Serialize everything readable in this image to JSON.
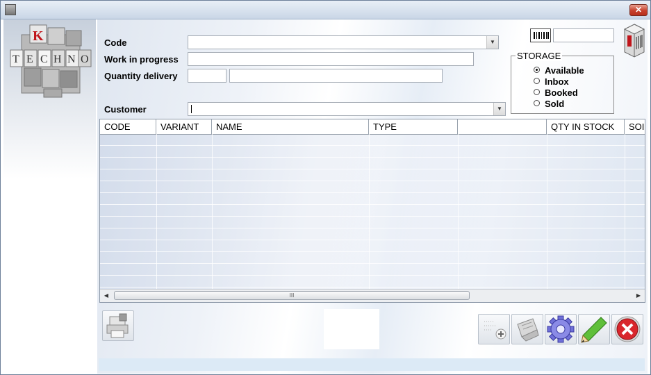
{
  "form": {
    "code_label": "Code",
    "wip_label": "Work in progress",
    "qty_label": "Quantity delivery",
    "customer_label": "Customer",
    "code_value": "",
    "wip_value": "",
    "qty_value": "",
    "qty_value2": "",
    "customer_value": "",
    "barcode_value": ""
  },
  "storage": {
    "legend": "STORAGE",
    "options": [
      "Available",
      "Inbox",
      "Booked",
      "Sold"
    ],
    "selected": "Available"
  },
  "grid": {
    "columns": [
      "CODE",
      "VARIANT",
      "NAME",
      "TYPE",
      "",
      "QTY IN STOCK",
      "SOI"
    ],
    "scroll_grip": "III"
  },
  "logo": {
    "letters": [
      "K",
      "T",
      "E",
      "C",
      "H",
      "N",
      "O"
    ],
    "accent": "#c0151b"
  },
  "icons": {
    "title": "app-icon",
    "close": "close-icon",
    "barcode": "barcode-icon",
    "cube": "cube-icon",
    "print": "print-icon",
    "add": "add-icon",
    "stamp": "stamp-icon",
    "settings": "gear-icon",
    "edit": "pencil-icon",
    "exit": "cancel-icon"
  }
}
